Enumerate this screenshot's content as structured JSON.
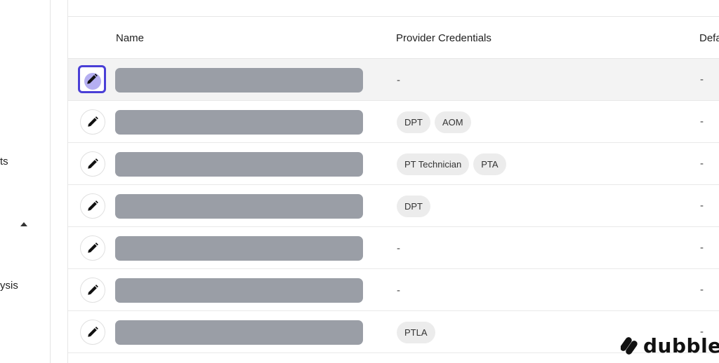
{
  "sidebar": {
    "items": [
      {
        "label": "ts"
      },
      {
        "label": "ysis"
      }
    ]
  },
  "table": {
    "headers": {
      "name": "Name",
      "credentials": "Provider Credentials",
      "default": "Defa"
    },
    "rows": [
      {
        "credentials": [],
        "cred_empty": "-",
        "default": "-"
      },
      {
        "credentials": [
          "DPT",
          "AOM"
        ],
        "cred_empty": "",
        "default": "-"
      },
      {
        "credentials": [
          "PT Technician",
          "PTA"
        ],
        "cred_empty": "",
        "default": "-"
      },
      {
        "credentials": [
          "DPT"
        ],
        "cred_empty": "",
        "default": "-"
      },
      {
        "credentials": [],
        "cred_empty": "-",
        "default": "-"
      },
      {
        "credentials": [],
        "cred_empty": "-",
        "default": "-"
      },
      {
        "credentials": [
          "PTLA"
        ],
        "cred_empty": "",
        "default": "-"
      }
    ]
  },
  "logo": {
    "text": "dubble"
  },
  "icons": {
    "edit": "pencil-icon",
    "caret": "caret-up-icon",
    "logo": "dubble-logo-icon"
  }
}
